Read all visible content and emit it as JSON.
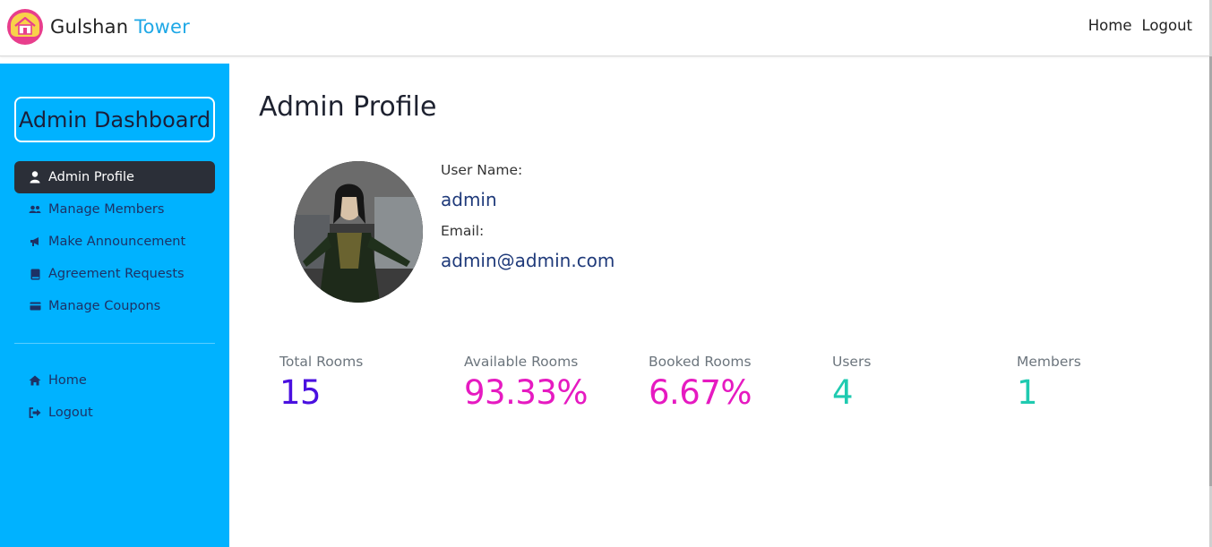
{
  "brand": {
    "name_part1": "Gulshan",
    "name_part2": "Tower",
    "logo_icon": "house-logo-icon"
  },
  "nav": {
    "home": "Home",
    "logout": "Logout"
  },
  "sidebar": {
    "title": "Admin Dashboard",
    "items": [
      {
        "label": "Admin Profile",
        "icon": "user-icon",
        "active": true
      },
      {
        "label": "Manage Members",
        "icon": "users-icon",
        "active": false
      },
      {
        "label": "Make Announcement",
        "icon": "megaphone-icon",
        "active": false
      },
      {
        "label": "Agreement Requests",
        "icon": "book-icon",
        "active": false
      },
      {
        "label": "Manage Coupons",
        "icon": "card-icon",
        "active": false
      }
    ],
    "bottom_items": [
      {
        "label": "Home",
        "icon": "home-icon"
      },
      {
        "label": "Logout",
        "icon": "logout-icon"
      }
    ]
  },
  "main": {
    "title": "Admin Profile",
    "profile": {
      "username_label": "User Name:",
      "username": "admin",
      "email_label": "Email:",
      "email": "admin@admin.com"
    },
    "stats": [
      {
        "label": "Total Rooms",
        "value": "15",
        "color": "#4a10e0"
      },
      {
        "label": "Available Rooms",
        "value": "93.33%",
        "color": "#e61ac1"
      },
      {
        "label": "Booked Rooms",
        "value": "6.67%",
        "color": "#e61ac1"
      },
      {
        "label": "Users",
        "value": "4",
        "color": "#1fcab0"
      },
      {
        "label": "Members",
        "value": "1",
        "color": "#1fcab0"
      }
    ]
  },
  "colors": {
    "sidebar_bg": "#00b2ff",
    "active_bg": "#2b2f38",
    "brand_accent": "#1fa8e6"
  }
}
